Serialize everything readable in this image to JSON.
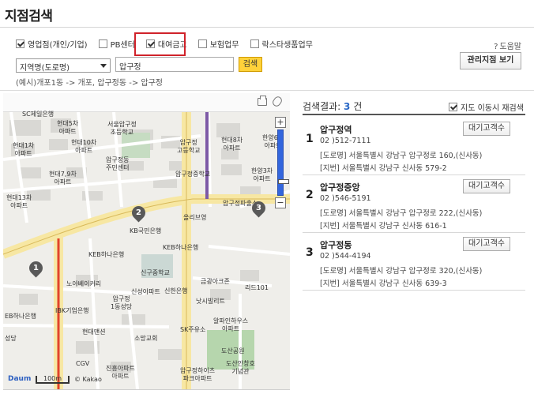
{
  "page": {
    "title": "지점검색"
  },
  "filters": [
    {
      "label": "영업점(개인/기업)",
      "checked": true
    },
    {
      "label": "PB센터",
      "checked": false
    },
    {
      "label": "대여금고",
      "checked": true
    },
    {
      "label": "보험업무",
      "checked": false
    },
    {
      "label": "락스타생품업무",
      "checked": false
    }
  ],
  "help": {
    "label": "도움말",
    "icon": "question-icon"
  },
  "search": {
    "region_select": "지역명(도로명)",
    "value": "압구정",
    "button": "검색",
    "example": "(예시)개포1동 -> 개포, 압구정동 -> 압구정"
  },
  "manage_button": "관리지점 보기",
  "map": {
    "labels": {
      "sc": "SC제일은행",
      "hd5": "현대5차\n아파트",
      "seoul_school": "서울압구정\n초등학교",
      "hd1": "현대1차\n아파트",
      "hd10": "현대10차\n아파트",
      "hd6": "현대6차\n아파트",
      "apgu_high": "압구정\n고등학교",
      "hd8": "현대8차\n아파트",
      "gongbo": "현대4차\n아파트",
      "hanyang": "한양6차\n아파트",
      "community": "압구정동\n주민센터",
      "apgu_mid": "압구정중학교",
      "hd9": "현대7,9차\n아파트",
      "hanyang2": "한양3차\n아파트",
      "hd13": "현대13차\n아파트",
      "hd_bldg": "현대",
      "apgu_exit": "압구정파출소",
      "kb": "KB국민은행",
      "olive": "올리브영",
      "keb1": "KEB하나은행",
      "keb2": "KEB하나은행",
      "shingu": "신구중학교",
      "noah": "노아베이커리",
      "shinsung": "신성아파트",
      "shinhan": "신한은행",
      "apgu_dong": "압구정\n1동성당",
      "keb3": "KEB하나은행",
      "ibk": "IBK기업은행",
      "geumgang": "금광아크존",
      "ritz": "리드101",
      "natsil": "낫시빌리트",
      "alpha": "알파인하우스\n아파트",
      "sk": "SK주유소",
      "hd_mansion": "현대맨션",
      "somang": "소망교회",
      "cgv": "CGV",
      "dosan": "도산공원",
      "dosan_memorial": "도산안창호\n기념관",
      "jindong": "진흥아파트\n아파트",
      "apgu_ipark": "압구정하이츠\n파크아파트",
      "seongdang": "성당",
      "keb_left": "EB하나은행"
    },
    "pins": [
      "1",
      "2",
      "3"
    ],
    "scale": "100m",
    "logo": "Daum",
    "kakao": "© Kakao"
  },
  "results": {
    "label": "검색결과:",
    "count": "3",
    "unit": "건",
    "rescan_label": "지도 이동시 재검색",
    "rescan_checked": true,
    "items": [
      {
        "num": "1",
        "name": "압구정역",
        "phone": "02 )512-7111",
        "road": "[도로명] 서울특별시 강남구 압구정로 160,(신사동)",
        "lot": "[지번] 서울특별시 강남구 신사동 579-2",
        "button": "대기고객수"
      },
      {
        "num": "2",
        "name": "압구정중앙",
        "phone": "02 )546-5191",
        "road": "[도로명] 서울특별시 강남구 압구정로 222,(신사동)",
        "lot": "[지번] 서울특별시 강남구 신사동 616-1",
        "button": "대기고객수"
      },
      {
        "num": "3",
        "name": "압구정동",
        "phone": "02 )544-4194",
        "road": "[도로명] 서울특별시 강남구 압구정로 320,(신사동)",
        "lot": "[지번] 서울특별시 강남구 신사동 639-3",
        "button": "대기고객수"
      }
    ]
  }
}
